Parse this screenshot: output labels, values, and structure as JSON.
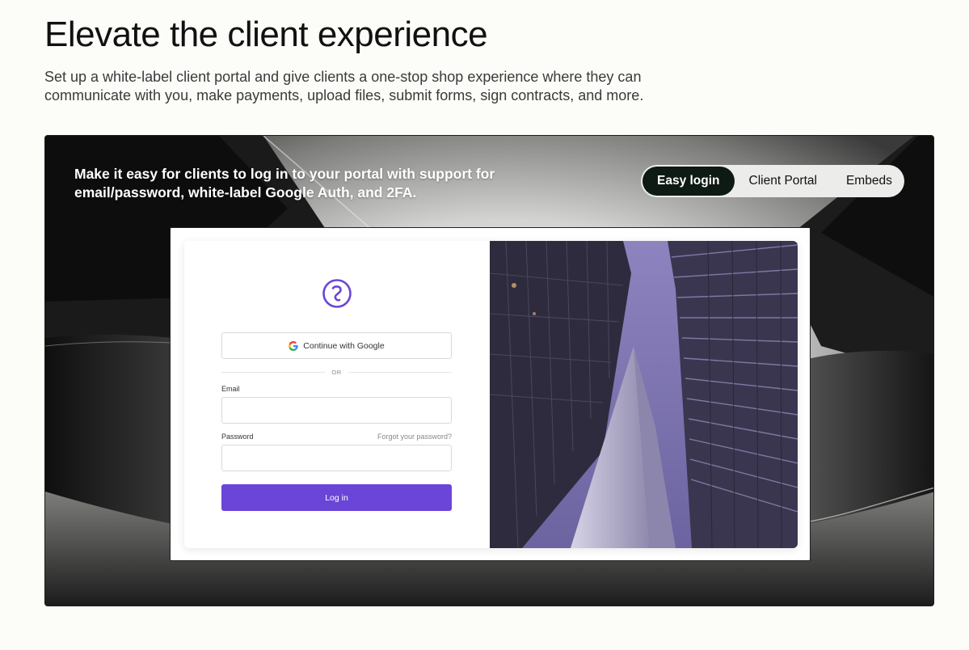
{
  "header": {
    "title": "Elevate the client experience",
    "subtitle": "Set up a white-label client portal and give clients a one-stop shop experience where they can communicate with you, make payments, upload files, submit forms, sign contracts, and more."
  },
  "hero": {
    "description": "Make it easy for clients to log in to your portal with support for email/password, white-label Google Auth, and 2FA.",
    "tabs": [
      {
        "label": "Easy login",
        "active": true
      },
      {
        "label": "Client Portal",
        "active": false
      },
      {
        "label": "Embeds",
        "active": false
      }
    ]
  },
  "login": {
    "logo_icon": "portal-logo-icon",
    "google_button": "Continue with Google",
    "or_text": "OR",
    "email_label": "Email",
    "email_value": "",
    "password_label": "Password",
    "password_value": "",
    "forgot_link": "Forgot your password?",
    "submit_label": "Log in"
  },
  "colors": {
    "accent": "#6b45d8",
    "active_tab": "#0e1a14",
    "photo_sky": "#7a6fae"
  }
}
